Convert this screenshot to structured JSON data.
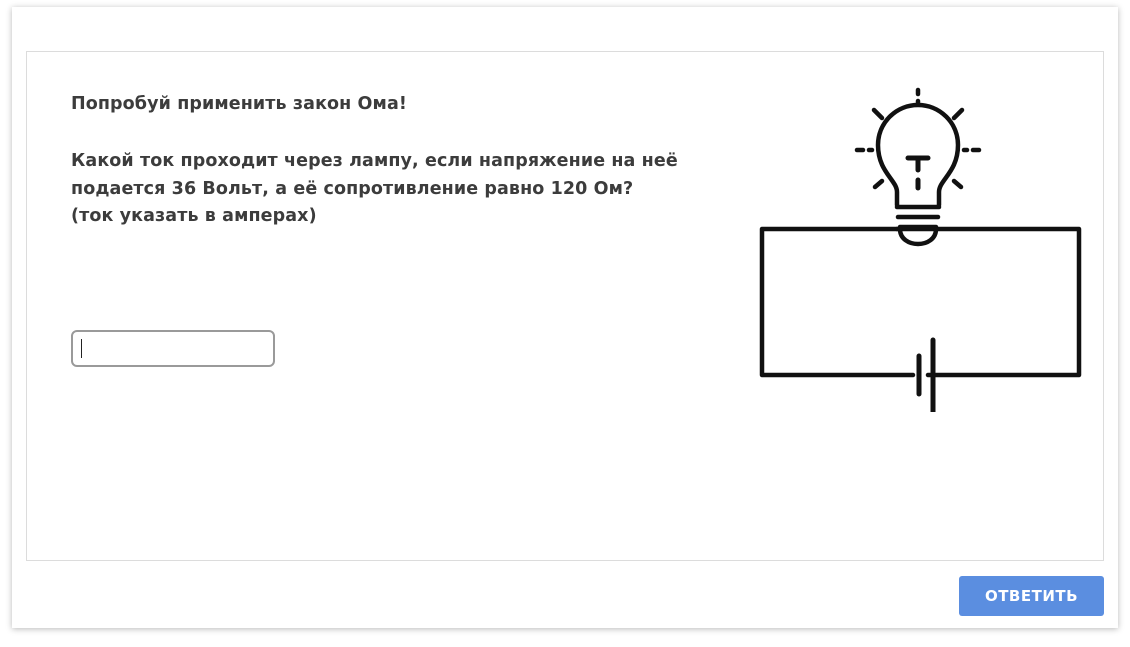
{
  "question": {
    "title": "Попробуй применить закон Ома!",
    "lines": [
      "Какой ток проходит через лампу, если напряжение на неё",
      "подается 36 Вольт, а её сопротивление равно 120 Ом?",
      "(ток указать в амперах)"
    ]
  },
  "answer": {
    "value": "",
    "placeholder": ""
  },
  "illustration": {
    "icon": "lightbulb-circuit-icon",
    "stroke_color": "#111111"
  },
  "actions": {
    "submit_label": "ОТВЕТИТЬ",
    "submit_color": "#5b8ee0"
  }
}
